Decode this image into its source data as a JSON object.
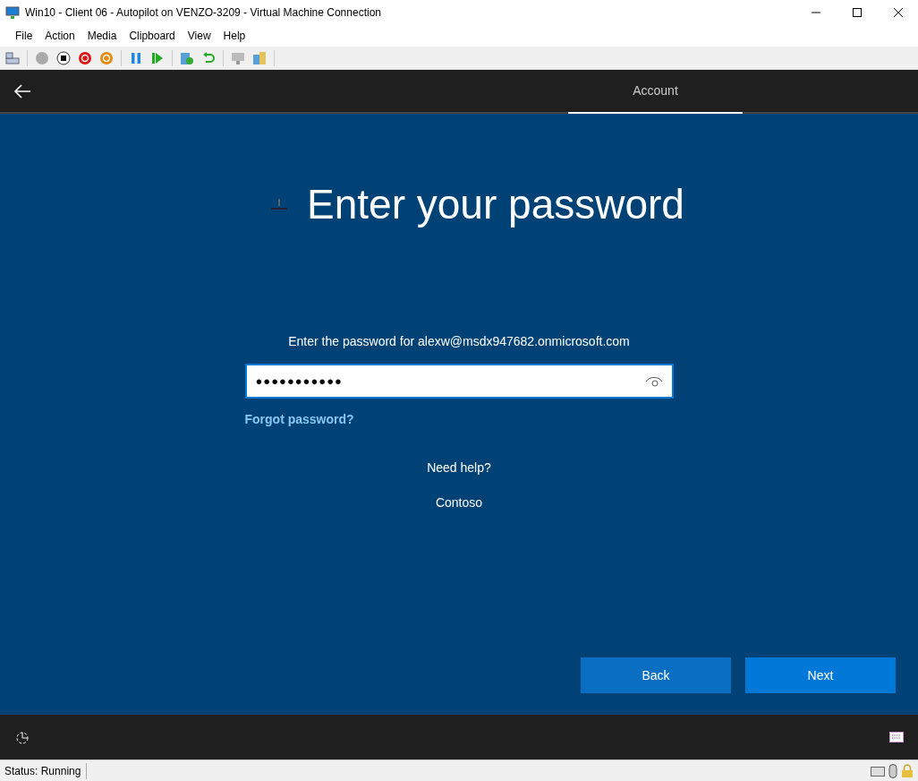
{
  "window": {
    "title": "Win10 - Client 06 - Autopilot on VENZO-3209 - Virtual Machine Connection"
  },
  "menu": [
    "File",
    "Action",
    "Media",
    "Clipboard",
    "View",
    "Help"
  ],
  "header": {
    "tabs": [
      {
        "label": "Account",
        "selected": true
      }
    ]
  },
  "page": {
    "title": "Enter your password",
    "prompt": "Enter the password for alexw@msdx947682.onmicrosoft.com",
    "password": "●●●●●●●●●●●",
    "forgot_link": "Forgot password?",
    "help_link": "Need help?",
    "org_link": "Contoso"
  },
  "buttons": [
    {
      "label": "Back",
      "kind": "secondary"
    },
    {
      "label": "Next",
      "kind": "primary"
    }
  ],
  "status_bar": {
    "text": "Status: Running"
  }
}
